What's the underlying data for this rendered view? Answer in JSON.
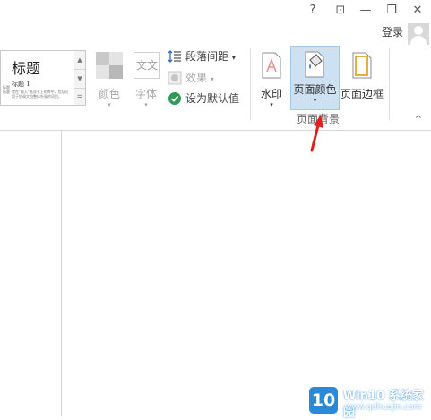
{
  "titlebar": {
    "help": "?",
    "ribbon_display": "⊡",
    "minimize": "—",
    "restore": "❐",
    "close": "✕",
    "login": "登录"
  },
  "ribbon": {
    "style_gallery": {
      "heading": "标题",
      "heading1": "标题 1",
      "sample_text": "就在\"插入\"选项卡上的库中，包括可用于协调文档整体外观的项目。",
      "sample_left": "标题 标题"
    },
    "colors_label": "颜色",
    "fonts_label": "字体",
    "paragraph_spacing": "段落间距",
    "effects": "效果",
    "set_default": "设为默认值",
    "watermark": "水印",
    "page_color": "页面颜色",
    "page_borders": "页面边框",
    "group_page_background": "页面背景",
    "collapse": "^",
    "drop_arrow": "▾"
  },
  "watermark": {
    "brand": "Win10 系统家园",
    "site": "www.qdhuajin.com",
    "badge": "10"
  },
  "colors": {
    "accent_red": "#e02020",
    "page_color_highlight": "#cde1f3"
  }
}
